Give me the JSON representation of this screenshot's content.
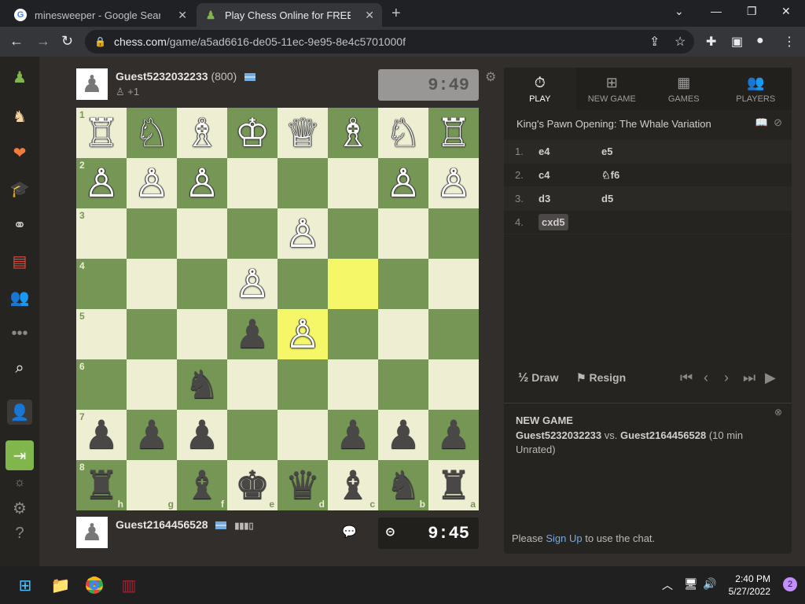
{
  "browser": {
    "tabs": [
      {
        "title": "minesweeper - Google Search",
        "favicon": "G"
      },
      {
        "title": "Play Chess Online for FREE with F",
        "favicon": "♟"
      }
    ],
    "url_host": "chess.com",
    "url_path": "/game/a5ad6616-de05-11ec-9e95-8e4c5701000f"
  },
  "top_player": {
    "name": "Guest5232032233",
    "rating": "(800)",
    "sub": "+1",
    "clock": "9:49"
  },
  "bottom_player": {
    "name": "Guest2164456528",
    "clock": "9:45"
  },
  "board": {
    "ranks": [
      "1",
      "2",
      "3",
      "4",
      "5",
      "6",
      "7",
      "8"
    ],
    "files": [
      "h",
      "g",
      "f",
      "e",
      "d",
      "c",
      "b",
      "a"
    ],
    "rows": [
      [
        "♖",
        "♘",
        "♗",
        "♔",
        "♕",
        "♗",
        "♘",
        "♖"
      ],
      [
        "♙",
        "♙",
        "♙",
        "",
        "",
        "",
        "♙",
        "♙"
      ],
      [
        "",
        "",
        "",
        "",
        "♙",
        "",
        "",
        ""
      ],
      [
        "",
        "",
        "",
        "♙",
        "",
        "",
        "",
        ""
      ],
      [
        "",
        "",
        "",
        "♟",
        "♙",
        "",
        "",
        ""
      ],
      [
        "",
        "",
        "♞",
        "",
        "",
        "",
        "",
        ""
      ],
      [
        "♟",
        "♟",
        "♟",
        "",
        "",
        "♟",
        "♟",
        "♟"
      ],
      [
        "♜",
        "",
        "♝",
        "♚",
        "♛",
        "♝",
        "♞",
        "♜"
      ]
    ],
    "white_rows": [
      0,
      1,
      2,
      3,
      4
    ],
    "highlights": [
      [
        3,
        5
      ],
      [
        4,
        4
      ]
    ]
  },
  "panel": {
    "tabs": [
      {
        "label": "PLAY",
        "icon": "stopwatch-icon"
      },
      {
        "label": "NEW GAME",
        "icon": "plus-icon"
      },
      {
        "label": "GAMES",
        "icon": "board-icon"
      },
      {
        "label": "PLAYERS",
        "icon": "players-icon"
      }
    ],
    "opening": "King's Pawn Opening: The Whale Variation",
    "moves": [
      {
        "num": "1.",
        "white": "e4",
        "black": "e5"
      },
      {
        "num": "2.",
        "white": "c4",
        "black": "♘f6"
      },
      {
        "num": "3.",
        "white": "d3",
        "black": "d5"
      },
      {
        "num": "4.",
        "white": "cxd5",
        "black": ""
      }
    ],
    "draw_label": "Draw",
    "draw_prefix": "½",
    "resign_label": "Resign"
  },
  "chat": {
    "title": "NEW GAME",
    "player1": "Guest5232032233",
    "vs": "vs.",
    "player2": "Guest2164456528",
    "mode": "(10 min Unrated)",
    "foot_pre": "Please",
    "foot_link": "Sign Up",
    "foot_post": "to use the chat."
  },
  "taskbar": {
    "time": "2:40 PM",
    "date": "5/27/2022",
    "notifications": "2"
  }
}
